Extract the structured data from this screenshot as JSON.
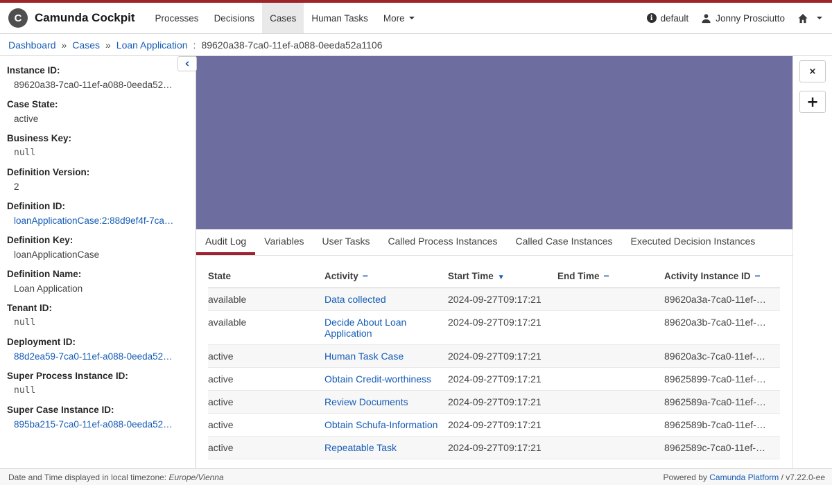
{
  "brand": {
    "logo_letter": "C",
    "title": "Camunda Cockpit"
  },
  "nav": {
    "items": [
      {
        "label": "Processes"
      },
      {
        "label": "Decisions"
      },
      {
        "label": "Cases"
      },
      {
        "label": "Human Tasks"
      }
    ],
    "active": "Cases",
    "more_label": "More"
  },
  "user": {
    "engine": "default",
    "name": "Jonny Prosciutto"
  },
  "breadcrumb": {
    "separator": "»",
    "colon": ":",
    "links": [
      {
        "label": "Dashboard"
      },
      {
        "label": "Cases"
      },
      {
        "label": "Loan Application"
      }
    ],
    "instance_id": "89620a38-7ca0-11ef-a088-0eeda52a1106"
  },
  "sidebar": {
    "collapse_glyph": "‹",
    "fields": [
      {
        "label": "Instance ID:",
        "value": "89620a38-7ca0-11ef-a088-0eeda52…",
        "type": "text"
      },
      {
        "label": "Case State:",
        "value": "active",
        "type": "text"
      },
      {
        "label": "Business Key:",
        "value": "null",
        "type": "code"
      },
      {
        "label": "Definition Version:",
        "value": "2",
        "type": "text"
      },
      {
        "label": "Definition ID:",
        "value": "loanApplicationCase:2:88d9ef4f-7ca…",
        "type": "link"
      },
      {
        "label": "Definition Key:",
        "value": "loanApplicationCase",
        "type": "text"
      },
      {
        "label": "Definition Name:",
        "value": "Loan Application",
        "type": "text"
      },
      {
        "label": "Tenant ID:",
        "value": "null",
        "type": "code"
      },
      {
        "label": "Deployment ID:",
        "value": "88d2ea59-7ca0-11ef-a088-0eeda52…",
        "type": "link"
      },
      {
        "label": "Super Process Instance ID:",
        "value": "null",
        "type": "code"
      },
      {
        "label": "Super Case Instance ID:",
        "value": "895ba215-7ca0-11ef-a088-0eeda52…",
        "type": "link"
      }
    ]
  },
  "diagram": {
    "reset_button_glyph": "×",
    "zoom_in_button_glyph": "+"
  },
  "tabs": [
    {
      "label": "Audit Log"
    },
    {
      "label": "Variables"
    },
    {
      "label": "User Tasks"
    },
    {
      "label": "Called Process Instances"
    },
    {
      "label": "Called Case Instances"
    },
    {
      "label": "Executed Decision Instances"
    }
  ],
  "active_tab": "Audit Log",
  "table": {
    "columns": [
      {
        "label": "State",
        "sort": "none",
        "sort_glyph": ""
      },
      {
        "label": "Activity",
        "sort": "sortable",
        "sort_glyph": "−"
      },
      {
        "label": "Start Time",
        "sort": "desc",
        "sort_glyph": "▼"
      },
      {
        "label": "End Time",
        "sort": "sortable",
        "sort_glyph": "−"
      },
      {
        "label": "Activity Instance ID",
        "sort": "sortable",
        "sort_glyph": "−"
      }
    ],
    "rows": [
      {
        "state": "available",
        "activity": "Data collected",
        "start": "2024-09-27T09:17:21",
        "end": "",
        "id": "89620a3a-7ca0-11ef-…"
      },
      {
        "state": "available",
        "activity": "Decide About Loan Application",
        "start": "2024-09-27T09:17:21",
        "end": "",
        "id": "89620a3b-7ca0-11ef-…"
      },
      {
        "state": "active",
        "activity": "Human Task Case",
        "start": "2024-09-27T09:17:21",
        "end": "",
        "id": "89620a3c-7ca0-11ef-…"
      },
      {
        "state": "active",
        "activity": "Obtain Credit-worthiness",
        "start": "2024-09-27T09:17:21",
        "end": "",
        "id": "89625899-7ca0-11ef-…"
      },
      {
        "state": "active",
        "activity": "Review Documents",
        "start": "2024-09-27T09:17:21",
        "end": "",
        "id": "8962589a-7ca0-11ef-…"
      },
      {
        "state": "active",
        "activity": "Obtain Schufa-Information",
        "start": "2024-09-27T09:17:21",
        "end": "",
        "id": "8962589b-7ca0-11ef-…"
      },
      {
        "state": "active",
        "activity": "Repeatable Task",
        "start": "2024-09-27T09:17:21",
        "end": "",
        "id": "8962589c-7ca0-11ef-…"
      }
    ]
  },
  "footer": {
    "timezone_prefix": "Date and Time displayed in local timezone:",
    "timezone": "Europe/Vienna",
    "powered_prefix": "Powered by",
    "platform_link": "Camunda Platform",
    "version_suffix": "/ v7.22.0-ee"
  },
  "colors": {
    "accent_red": "#9e2428",
    "active_tab_underline": "#9e2130",
    "link_blue": "#155cb5",
    "nav_active_bg": "#e9e9e9",
    "stripe_bg": "#f7f7f8",
    "footer_bg": "#f7f7f7"
  }
}
